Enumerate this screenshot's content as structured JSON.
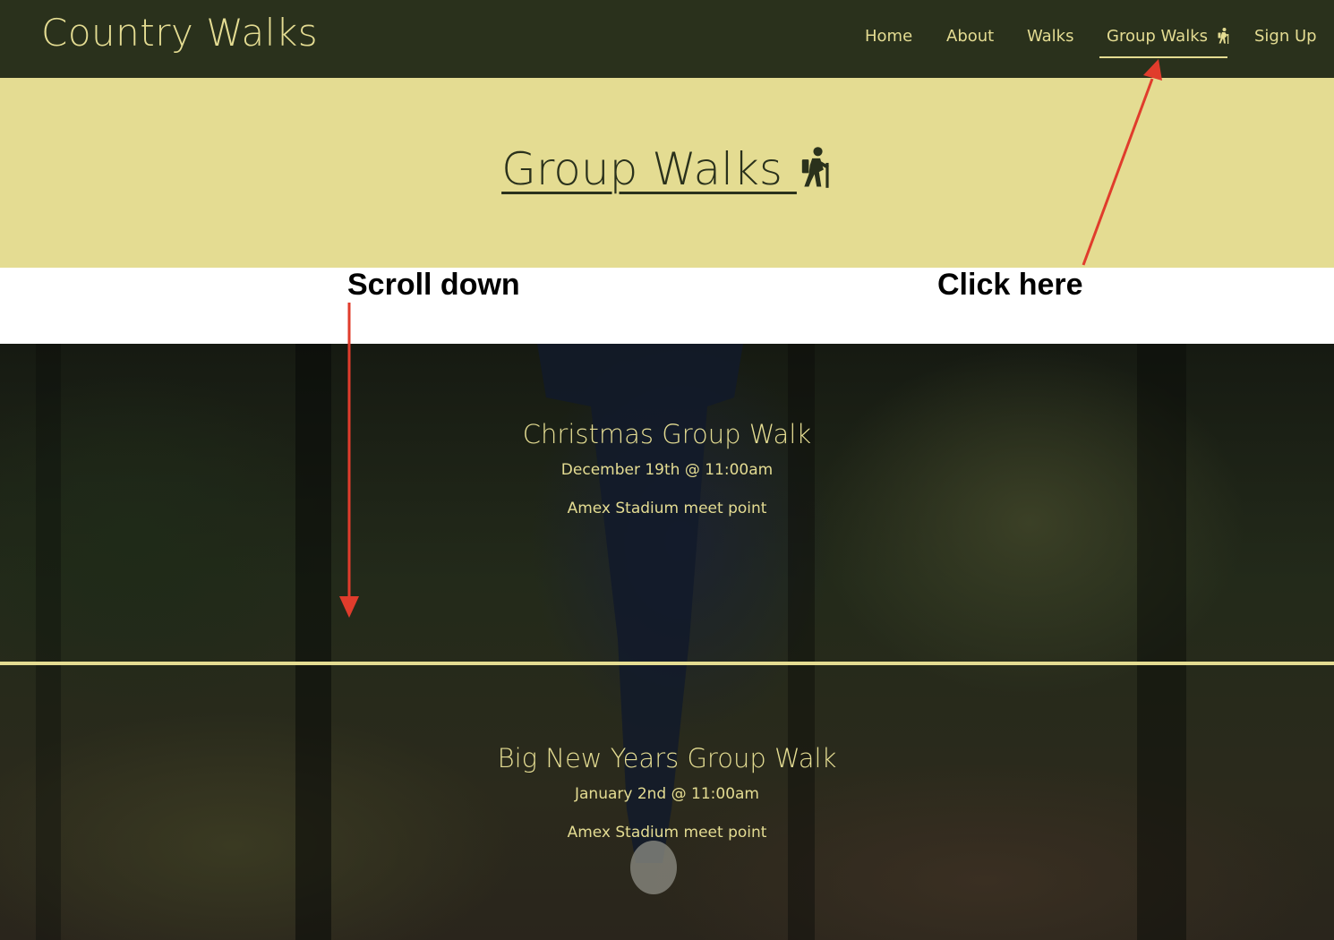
{
  "header": {
    "brand": "Country Walks",
    "nav": [
      {
        "label": "Home"
      },
      {
        "label": "About"
      },
      {
        "label": "Walks"
      },
      {
        "label": "Group Walks",
        "icon": "hiker-icon",
        "active": true
      },
      {
        "label": "Sign Up"
      }
    ]
  },
  "hero": {
    "title": "Group Walks",
    "icon": "hiker-icon"
  },
  "annotations": {
    "scroll": "Scroll down",
    "click": "Click here",
    "arrow_color": "#e03c2c"
  },
  "walks": [
    {
      "title": "Christmas Group Walk",
      "date": "December 19th @ 11:00am",
      "place": "Amex Stadium meet point"
    },
    {
      "title": "Big New Years Group Walk",
      "date": "January 2nd @ 11:00am",
      "place": "Amex Stadium meet point"
    }
  ],
  "colors": {
    "nav_bg": "#2a311c",
    "accent": "#e4dc92",
    "title_text": "#2a311c"
  }
}
